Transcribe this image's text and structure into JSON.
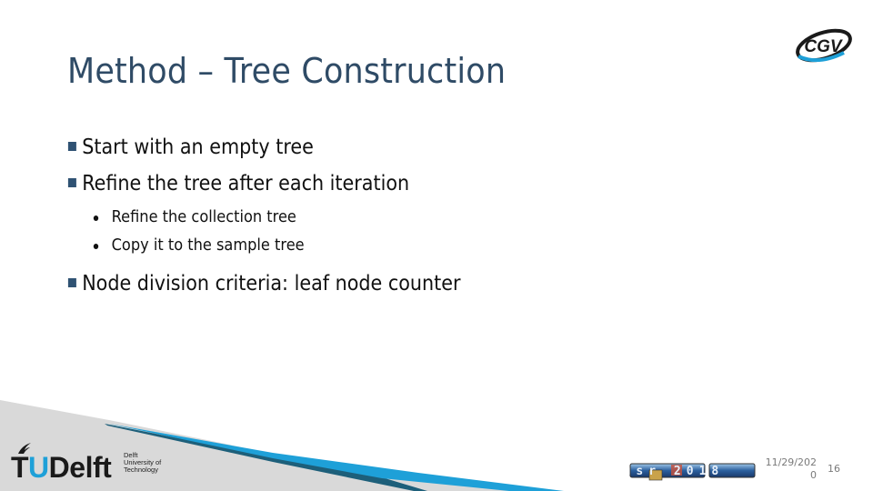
{
  "slide": {
    "title": "Method – Tree Construction",
    "bullets": [
      {
        "level": 1,
        "text": "Start with an empty tree"
      },
      {
        "level": 1,
        "text": "Refine the tree after each iteration"
      },
      {
        "level": 2,
        "text": "Refine the collection tree"
      },
      {
        "level": 2,
        "text": "Copy it to the sample tree"
      },
      {
        "level": 1,
        "text": "Node division criteria: leaf node counter"
      }
    ]
  },
  "logos": {
    "cgv": "CGV",
    "tudelft_main_t": "T",
    "tudelft_main_u": "U",
    "tudelft_main_rest": "Delft",
    "tudelft_sub": [
      "Delft",
      "University of",
      "Technology"
    ],
    "egsr": "egsr 2018"
  },
  "footer": {
    "date_line1": "11/29/202",
    "date_line2": "0",
    "page_number": "16"
  },
  "colors": {
    "title": "#2f4b66",
    "accent_blue": "#1ea0d8",
    "accent_dark": "#1d5f7a",
    "footer_gray": "#d9d9d9"
  }
}
